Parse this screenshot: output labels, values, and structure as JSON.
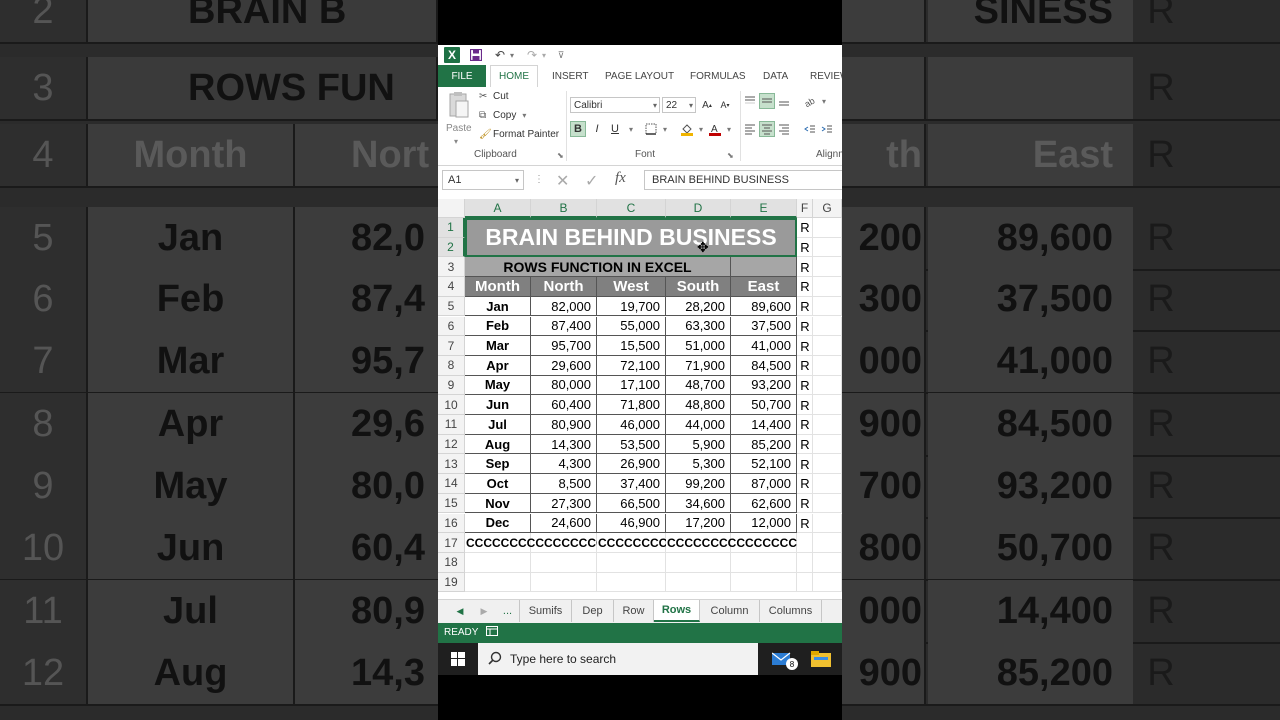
{
  "background": {
    "left_rows": [
      {
        "row": "2",
        "month": "BRAIN B",
        "north": ""
      },
      {
        "row": "3",
        "month": "ROWS FUN",
        "north": ""
      },
      {
        "row": "4",
        "month": "Month",
        "north": "Nort"
      },
      {
        "row": "5",
        "month": "Jan",
        "north": "82,0"
      },
      {
        "row": "6",
        "month": "Feb",
        "north": "87,4"
      },
      {
        "row": "7",
        "month": "Mar",
        "north": "95,7"
      },
      {
        "row": "8",
        "month": "Apr",
        "north": "29,6"
      },
      {
        "row": "9",
        "month": "May",
        "north": "80,0"
      },
      {
        "row": "10",
        "month": "Jun",
        "north": "60,4"
      },
      {
        "row": "11",
        "month": "Jul",
        "north": "80,9"
      },
      {
        "row": "12",
        "month": "Aug",
        "north": "14,3"
      }
    ],
    "right_rows": [
      {
        "a": "",
        "b": "SINESS",
        "r": "R"
      },
      {
        "a": "",
        "b": "",
        "r": "R"
      },
      {
        "a": "th",
        "b": "East",
        "r": "R"
      },
      {
        "a": "200",
        "b": "89,600",
        "r": "R"
      },
      {
        "a": "300",
        "b": "37,500",
        "r": "R"
      },
      {
        "a": "000",
        "b": "41,000",
        "r": "R"
      },
      {
        "a": "900",
        "b": "84,500",
        "r": "R"
      },
      {
        "a": "700",
        "b": "93,200",
        "r": "R"
      },
      {
        "a": "800",
        "b": "50,700",
        "r": "R"
      },
      {
        "a": "000",
        "b": "14,400",
        "r": "R"
      },
      {
        "a": "900",
        "b": "85,200",
        "r": "R"
      }
    ]
  },
  "qat": {
    "undo": "↶",
    "redo": "↷"
  },
  "ribbon_tabs": [
    "FILE",
    "HOME",
    "INSERT",
    "PAGE LAYOUT",
    "FORMULAS",
    "DATA",
    "REVIEW"
  ],
  "clipboard": {
    "paste": "Paste",
    "cut": "Cut",
    "copy": "Copy",
    "format_painter": "Format Painter",
    "label": "Clipboard"
  },
  "font": {
    "name": "Calibri",
    "size": "22",
    "label": "Font",
    "bold": "B",
    "italic": "I",
    "underline": "U"
  },
  "alignment": {
    "label": "Alignm"
  },
  "formula_bar": {
    "name_box": "A1",
    "fx": "fx",
    "content": "BRAIN BEHIND BUSINESS"
  },
  "columns": [
    "A",
    "B",
    "C",
    "D",
    "E",
    "F",
    "G"
  ],
  "rows": [
    "1",
    "2",
    "3",
    "4",
    "5",
    "6",
    "7",
    "8",
    "9",
    "10",
    "11",
    "12",
    "13",
    "14",
    "15",
    "16",
    "17",
    "18",
    "19"
  ],
  "sheet": {
    "title": "BRAIN BEHIND BUSINESS",
    "subtitle": "ROWS FUNCTION IN EXCEL",
    "headers": [
      "Month",
      "North",
      "West",
      "South",
      "East"
    ],
    "data": [
      [
        "Jan",
        "82,000",
        "19,700",
        "28,200",
        "89,600"
      ],
      [
        "Feb",
        "87,400",
        "55,000",
        "63,300",
        "37,500"
      ],
      [
        "Mar",
        "95,700",
        "15,500",
        "51,000",
        "41,000"
      ],
      [
        "Apr",
        "29,600",
        "72,100",
        "71,900",
        "84,500"
      ],
      [
        "May",
        "80,000",
        "17,100",
        "48,700",
        "93,200"
      ],
      [
        "Jun",
        "60,400",
        "71,800",
        "48,800",
        "50,700"
      ],
      [
        "Jul",
        "80,900",
        "46,000",
        "44,000",
        "14,400"
      ],
      [
        "Aug",
        "14,300",
        "53,500",
        "5,900",
        "85,200"
      ],
      [
        "Sep",
        "4,300",
        "26,900",
        "5,300",
        "52,100"
      ],
      [
        "Oct",
        "8,500",
        "37,400",
        "99,200",
        "87,000"
      ],
      [
        "Nov",
        "27,300",
        "66,500",
        "34,600",
        "62,600"
      ],
      [
        "Dec",
        "24,600",
        "46,900",
        "17,200",
        "12,000"
      ]
    ],
    "f_column": [
      "R",
      "R",
      "R",
      "R",
      "R",
      "R",
      "R",
      "R",
      "R",
      "R",
      "R",
      "R",
      "R",
      "R",
      "R",
      "R"
    ],
    "row17": [
      "CCCCCCCCCCCCCCCC",
      "CCCCCCCC",
      "CCCCCCCCCCCCCCCC"
    ]
  },
  "sheet_tabs": [
    "...",
    "Sumifs",
    "Dep",
    "Row",
    "Rows",
    "Column",
    "Columns"
  ],
  "active_sheet": "Rows",
  "status": {
    "text": "READY"
  },
  "taskbar": {
    "search_placeholder": "Type here to search",
    "mail_badge": "8"
  },
  "colors": {
    "excel_green": "#217346",
    "header_fill": "#808080",
    "title_fill": "#9a9a9a"
  }
}
